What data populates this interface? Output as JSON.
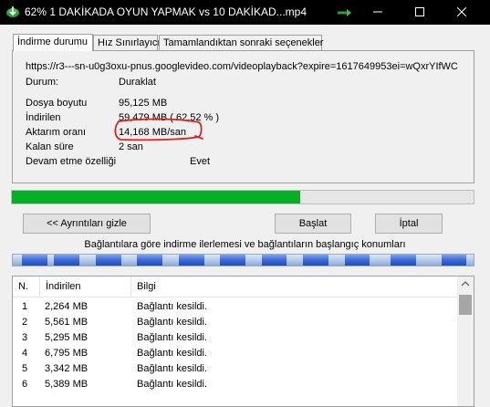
{
  "window": {
    "title": "62% 1 DAKİKADA OYUN YAPMAK vs 10 DAKİKAD...mp4"
  },
  "tabs": [
    {
      "label": "İndirme durumu",
      "active": true
    },
    {
      "label": "Hız Sınırlayıcı",
      "active": false
    },
    {
      "label": "Tamamlandıktan sonraki seçenekler",
      "active": false
    }
  ],
  "status": {
    "url": "https://r3---sn-u0g3oxu-pnus.googlevideo.com/videoplayback?expire=1617649953ei=wQxrYIfWC",
    "state_label": "Durum:",
    "state_value": "Duraklat",
    "file_size_label": "Dosya boyutu",
    "file_size_value": "95,125  MB",
    "downloaded_label": "İndirilen",
    "downloaded_value": "59,479  MB  ( 62,52 % )",
    "rate_label": "Aktarım oranı",
    "rate_value": "14,168  MB/san",
    "time_left_label": "Kalan süre",
    "time_left_value": "2 san",
    "resume_label": "Devam etme özelliği",
    "resume_value": "Evet"
  },
  "progress": {
    "percent": 62.52,
    "color": "#06b025"
  },
  "buttons": {
    "details": "<< Ayrıntıları gizle",
    "start": "Başlat",
    "cancel": "İptal"
  },
  "connections": {
    "caption": "Bağlantılara göre indirme ilerlemesi ve bağlantıların başlangıç konumları",
    "segments": [
      0.02,
      0.09,
      0.18,
      0.27,
      0.36,
      0.45,
      0.54,
      0.63,
      0.72,
      0.82,
      0.93
    ]
  },
  "table": {
    "headers": [
      "N.",
      "İndirilen",
      "Bilgi"
    ],
    "rows": [
      [
        "1",
        "2,264  MB",
        "Bağlantı kesildi."
      ],
      [
        "2",
        "5,561  MB",
        "Bağlantı kesildi."
      ],
      [
        "3",
        "5,295  MB",
        "Bağlantı kesildi."
      ],
      [
        "4",
        "6,795  MB",
        "Bağlantı kesildi."
      ],
      [
        "5",
        "3,342  MB",
        "Bağlantı kesildi."
      ],
      [
        "6",
        "5,389  MB",
        "Bağlantı kesildi."
      ]
    ]
  },
  "icons": {
    "app": "idm-icon",
    "annotation": "red-hand-drawn-circle"
  },
  "colors": {
    "title_bar": "#000000",
    "accent_annotation": "#e0201a",
    "progress_fill": "#06b025"
  }
}
